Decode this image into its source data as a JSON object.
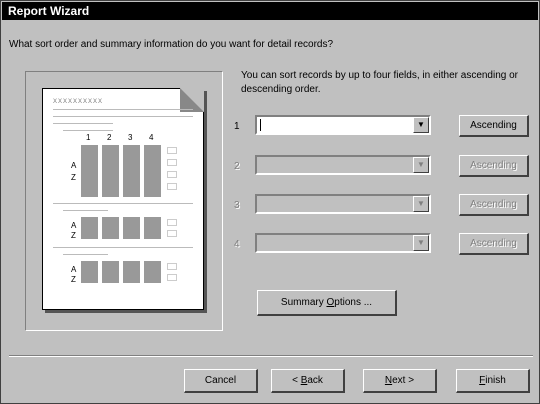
{
  "window": {
    "title": "Report Wizard"
  },
  "question": "What sort order and summary information do you want for detail records?",
  "preview": {
    "header_text": "XXXXXXXXXX",
    "column_numbers": [
      "1",
      "2",
      "3",
      "4"
    ],
    "row_letters": [
      "A",
      "Z"
    ]
  },
  "instructions": "You can sort records by up to four fields, in either ascending or descending order.",
  "sort_fields": [
    {
      "number": "1",
      "value": "",
      "button": "Ascending",
      "enabled": true
    },
    {
      "number": "2",
      "value": "",
      "button": "Ascending",
      "enabled": false
    },
    {
      "number": "3",
      "value": "",
      "button": "Ascending",
      "enabled": false
    },
    {
      "number": "4",
      "value": "",
      "button": "Ascending",
      "enabled": false
    }
  ],
  "summary_button": {
    "prefix": "Summary ",
    "accel": "O",
    "suffix": "ptions ..."
  },
  "buttons": {
    "cancel": "Cancel",
    "back": {
      "prefix": "< ",
      "accel": "B",
      "suffix": "ack"
    },
    "next": {
      "accel": "N",
      "suffix": "ext >"
    },
    "finish": {
      "accel": "F",
      "suffix": "inish"
    }
  }
}
